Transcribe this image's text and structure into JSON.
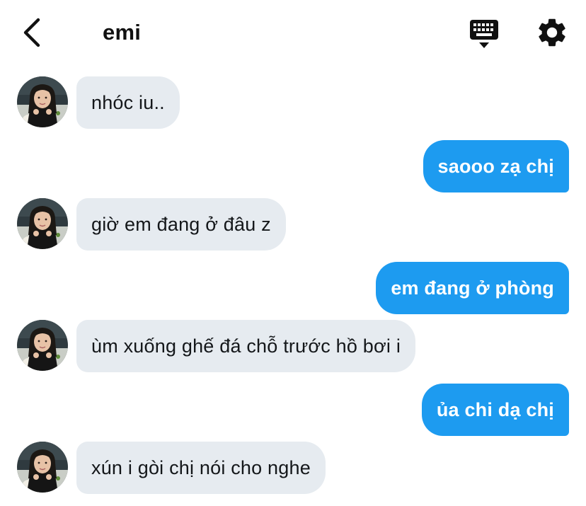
{
  "header": {
    "title": "emi",
    "back_icon": "chevron-left-icon",
    "keyboard_icon": "keyboard-icon",
    "settings_icon": "gear-icon"
  },
  "colors": {
    "incoming_bubble": "#e6ebf0",
    "outgoing_bubble": "#1d9bf0",
    "incoming_text": "#14171a",
    "outgoing_text": "#ffffff"
  },
  "messages": [
    {
      "side": "in",
      "text": "nhóc iu.."
    },
    {
      "side": "out",
      "text": "saooo zạ chị"
    },
    {
      "side": "in",
      "text": "giờ em đang ở đâu z"
    },
    {
      "side": "out",
      "text": "em đang ở phòng"
    },
    {
      "side": "in",
      "text": "ùm xuống ghế đá chỗ trước hồ bơi i"
    },
    {
      "side": "out",
      "text": "ủa chi dạ chị"
    },
    {
      "side": "in",
      "text": "xún i gòi chị nói cho nghe"
    }
  ]
}
